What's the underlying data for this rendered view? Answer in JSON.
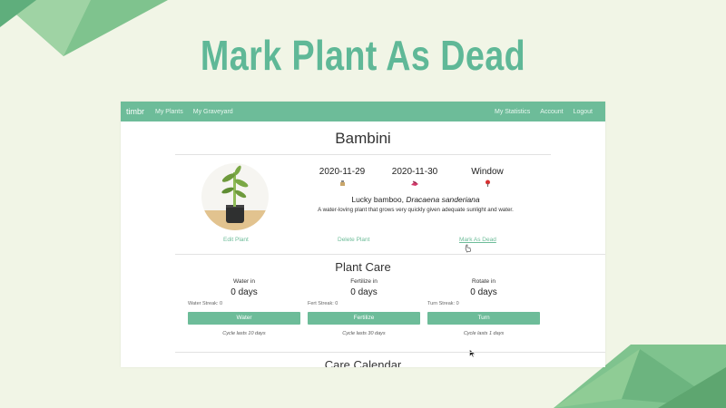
{
  "headline": "Mark Plant As Dead",
  "colors": {
    "accent": "#6dbc99",
    "headline": "#5fb897",
    "background": "#f1f5e6"
  },
  "navbar": {
    "brand": "timbr",
    "left": [
      "My Plants",
      "My Graveyard"
    ],
    "right": [
      "My Statistics",
      "Account",
      "Logout"
    ]
  },
  "plant": {
    "name": "Bambini",
    "stats": [
      {
        "value": "2020-11-29",
        "icon": "watering-can-icon"
      },
      {
        "value": "2020-11-30",
        "icon": "fertilizer-icon"
      },
      {
        "value": "Window",
        "icon": "location-pin-icon"
      }
    ],
    "common_name": "Lucky bamboo, ",
    "scientific_name": "Dracaena sanderiana",
    "description": "A water-loving plant that grows very quickly given adequate sunlight and water."
  },
  "actions": {
    "edit": "Edit Plant",
    "delete": "Delete Plant",
    "mark_dead": "Mark As Dead"
  },
  "care": {
    "title": "Plant Care",
    "columns": [
      {
        "label": "Water in",
        "value": "0 days",
        "streak": "Water Streak: 0",
        "button": "Water",
        "cycle": "Cycle lasts 10 days"
      },
      {
        "label": "Fertilize in",
        "value": "0 days",
        "streak": "Fert Streak: 0",
        "button": "Fertilize",
        "cycle": "Cycle lasts 30 days"
      },
      {
        "label": "Rotate in",
        "value": "0 days",
        "streak": "Turn Streak: 0",
        "button": "Turn",
        "cycle": "Cycle lasts 1 days"
      }
    ]
  },
  "calendar": {
    "title": "Care Calendar"
  }
}
